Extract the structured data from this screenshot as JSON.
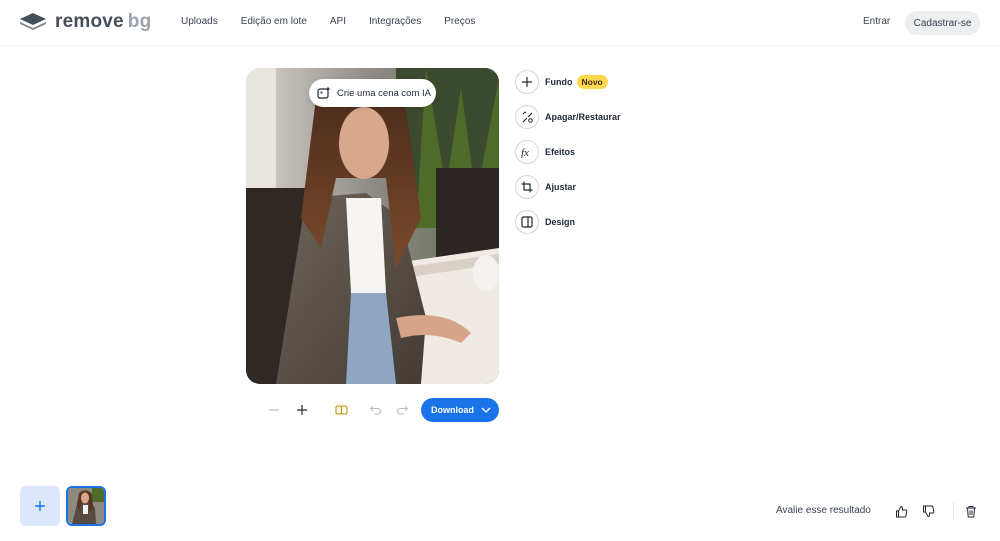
{
  "brand": {
    "name_main": "remove",
    "name_secondary": "bg"
  },
  "nav": {
    "items": [
      {
        "label": "Uploads"
      },
      {
        "label": "Edição em lote"
      },
      {
        "label": "API"
      },
      {
        "label": "Integrações"
      },
      {
        "label": "Preços"
      }
    ]
  },
  "auth": {
    "login_label": "Entrar",
    "signup_label": "Cadastrar-se"
  },
  "editor": {
    "ai_scene_label": "Crie uma cena com IA",
    "tools": [
      {
        "label": "Fundo",
        "icon": "plus-icon",
        "badge": "Novo"
      },
      {
        "label": "Apagar/Restaurar",
        "icon": "eraser-brush-icon"
      },
      {
        "label": "Efeitos",
        "icon": "fx-icon"
      },
      {
        "label": "Ajustar",
        "icon": "crop-icon"
      },
      {
        "label": "Design",
        "icon": "layout-icon"
      }
    ],
    "download_label": "Download"
  },
  "footer": {
    "rate_label": "Avalie esse resultado"
  },
  "colors": {
    "accent": "#1a73e8",
    "badge": "#ffd84d",
    "upload_tile": "#dbe8fb"
  }
}
